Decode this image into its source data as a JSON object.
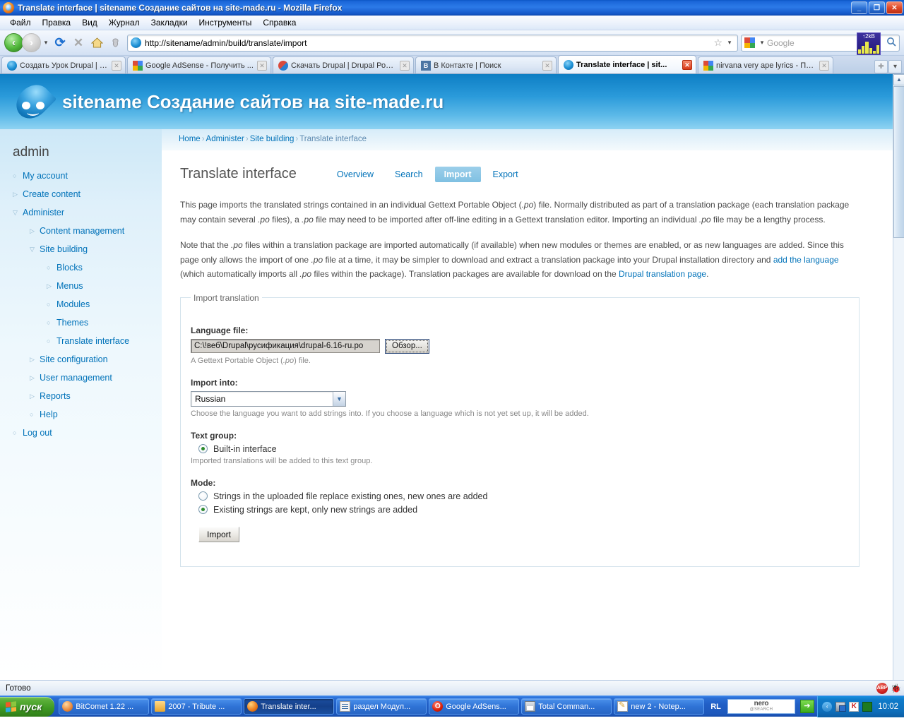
{
  "window": {
    "title": "Translate interface | sitename Создание сайтов на site-made.ru - Mozilla Firefox",
    "minimize_label": "_",
    "restore_label": "❐",
    "close_label": "✕"
  },
  "menubar": [
    {
      "label": "Файл"
    },
    {
      "label": "Правка"
    },
    {
      "label": "Вид"
    },
    {
      "label": "Журнал"
    },
    {
      "label": "Закладки"
    },
    {
      "label": "Инструменты"
    },
    {
      "label": "Справка"
    }
  ],
  "navbar": {
    "back_icon": "‹",
    "forward_icon": "›",
    "history_dropdown_icon": "▾",
    "reload_icon": "⟳",
    "stop_icon": "✕",
    "home_icon": "⌂",
    "feed_icon": "❧",
    "url": "http://sitename/admin/build/translate/import",
    "bookmark_star_icon": "☆",
    "urlbar_dropdown_icon": "▾",
    "search_placeholder": "Google",
    "search_engine_dropdown_icon": "▾",
    "search_go_icon": "🔍",
    "netmon_label": "↑2kB"
  },
  "browser_tabs": [
    {
      "label": "Создать Урок Drupal | Созд...",
      "favicon": "drupal-favicon",
      "active": false,
      "close_icon": "✕"
    },
    {
      "label": "Google AdSense - Получить ...",
      "favicon": "google-favicon",
      "active": false,
      "close_icon": "✕"
    },
    {
      "label": "Скачать Drupal | Drupal Росс...",
      "favicon": "drupalru-favicon",
      "active": false,
      "close_icon": "✕"
    },
    {
      "label": "В Контакте | Поиск",
      "favicon": "vk-favicon",
      "active": false,
      "close_icon": "✕"
    },
    {
      "label": "Translate interface | sit...",
      "favicon": "drupal-favicon",
      "active": true,
      "close_icon": "✕"
    },
    {
      "label": "nirvana very ape lyrics - Поис...",
      "favicon": "google-favicon",
      "active": false,
      "close_icon": "✕"
    }
  ],
  "tabbar_controls": {
    "new_tab_icon": "✛",
    "tab_list_icon": "▾"
  },
  "site": {
    "name": "sitename Создание сайтов на site-made.ru",
    "logo_name": "drupal-drop-logo"
  },
  "breadcrumb": {
    "items": [
      "Home",
      "Administer",
      "Site building",
      "Translate interface"
    ],
    "separator": "›"
  },
  "sidebar": {
    "user": "admin",
    "items": [
      {
        "label": "My account",
        "level": 1,
        "bullet": "circle"
      },
      {
        "label": "Create content",
        "level": 1,
        "bullet": "collapsed"
      },
      {
        "label": "Administer",
        "level": 1,
        "bullet": "expanded"
      },
      {
        "label": "Content management",
        "level": 2,
        "bullet": "collapsed"
      },
      {
        "label": "Site building",
        "level": 2,
        "bullet": "expanded"
      },
      {
        "label": "Blocks",
        "level": 3,
        "bullet": "circle"
      },
      {
        "label": "Menus",
        "level": 3,
        "bullet": "collapsed"
      },
      {
        "label": "Modules",
        "level": 3,
        "bullet": "circle"
      },
      {
        "label": "Themes",
        "level": 3,
        "bullet": "circle"
      },
      {
        "label": "Translate interface",
        "level": 3,
        "bullet": "circle"
      },
      {
        "label": "Site configuration",
        "level": 2,
        "bullet": "collapsed"
      },
      {
        "label": "User management",
        "level": 2,
        "bullet": "collapsed"
      },
      {
        "label": "Reports",
        "level": 2,
        "bullet": "collapsed"
      },
      {
        "label": "Help",
        "level": 2,
        "bullet": "circle"
      },
      {
        "label": "Log out",
        "level": 1,
        "bullet": "circle"
      }
    ]
  },
  "page": {
    "title": "Translate interface",
    "tabs": [
      {
        "label": "Overview",
        "active": false
      },
      {
        "label": "Search",
        "active": false
      },
      {
        "label": "Import",
        "active": true
      },
      {
        "label": "Export",
        "active": false
      }
    ],
    "paragraph1": {
      "p1a": "This page imports the translated strings contained in an individual Gettext Portable Object (",
      "po1": ".po",
      "p1b": ") file. Normally distributed as part of a translation package (each translation package may contain several ",
      "po2": ".po",
      "p1c": " files), a ",
      "po3": ".po",
      "p1d": " file may need to be imported after off-line editing in a Gettext translation editor. Importing an individual ",
      "po4": ".po",
      "p1e": " file may be a lengthy process."
    },
    "paragraph2": {
      "p2a": "Note that the ",
      "po1": ".po",
      "p2b": " files within a translation package are imported automatically (if available) when new modules or themes are enabled, or as new languages are added. Since this page only allows the import of one ",
      "po2": ".po",
      "p2c": " file at a time, it may be simpler to download and extract a translation package into your Drupal installation directory and ",
      "link1": "add the language",
      "p2d": " (which automatically imports all ",
      "po3": ".po",
      "p2e": " files within the package). Translation packages are available for download on the ",
      "link2": "Drupal translation page",
      "p2f": "."
    }
  },
  "form": {
    "legend": "Import translation",
    "language_file": {
      "label": "Language file:",
      "value": "C:\\!веб\\Drupal\\русификация\\drupal-6.16-ru.po",
      "browse_label": "Обзор...",
      "desc_a": "A Gettext Portable Object (",
      "desc_po": ".po",
      "desc_b": ") file."
    },
    "import_into": {
      "label": "Import into:",
      "selected": "Russian",
      "dropdown_icon": "▼",
      "description": "Choose the language you want to add strings into. If you choose a language which is not yet set up, it will be added."
    },
    "text_group": {
      "label": "Text group:",
      "options": [
        {
          "label": "Built-in interface",
          "selected": true
        }
      ],
      "description": "Imported translations will be added to this text group."
    },
    "mode": {
      "label": "Mode:",
      "options": [
        {
          "label": "Strings in the uploaded file replace existing ones, new ones are added",
          "selected": false
        },
        {
          "label": "Existing strings are kept, only new strings are added",
          "selected": true
        }
      ]
    },
    "submit_label": "Import"
  },
  "scrollbar": {
    "up_icon": "▲",
    "down_icon": "▼"
  },
  "statusbar": {
    "text": "Готово",
    "abp_label": "ABP",
    "firebug_icon": "🐞"
  },
  "taskbar": {
    "start_label": "пуск",
    "items": [
      {
        "label": "BitComet 1.22 ...",
        "icon": "bitcomet",
        "active": false
      },
      {
        "label": "2007 - Tribute ...",
        "icon": "folder",
        "active": false
      },
      {
        "label": "Translate inter...",
        "icon": "firefox",
        "active": true
      },
      {
        "label": "раздел Модул...",
        "icon": "doc",
        "active": false
      },
      {
        "label": "Google AdSens...",
        "icon": "opera",
        "active": false
      },
      {
        "label": "Total Comman...",
        "icon": "tc",
        "active": false
      },
      {
        "label": "new  2 - Notep...",
        "icon": "notepad",
        "active": false
      }
    ],
    "rl_label": "RL",
    "nero_line1": "nero",
    "nero_line2": "@SEARCH",
    "nero_go_icon": "➔",
    "nero_dropdown_icon": "▾",
    "tray_expand_icon": "‹",
    "clock": "10:02"
  }
}
